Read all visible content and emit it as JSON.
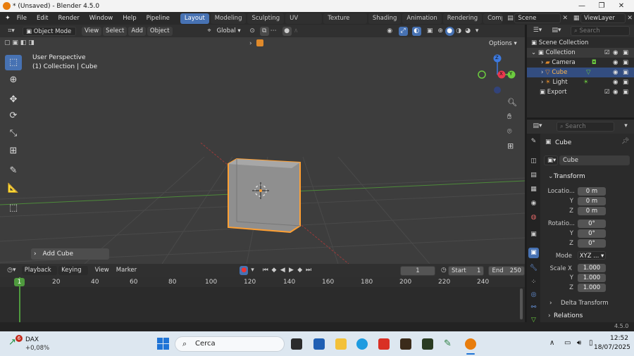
{
  "window": {
    "title": "* (Unsaved) - Blender 4.5.0"
  },
  "menu": {
    "items": [
      "File",
      "Edit",
      "Render",
      "Window",
      "Help",
      "Pipeline"
    ]
  },
  "workspaces": [
    "Layout",
    "Modeling",
    "Sculpting",
    "UV Editing",
    "Texture Paint",
    "Shading",
    "Animation",
    "Rendering",
    "Comp"
  ],
  "scene": {
    "name": "Scene",
    "view_layer": "ViewLayer"
  },
  "viewport_header": {
    "mode": "Object Mode",
    "menus": [
      "View",
      "Select",
      "Add",
      "Object"
    ],
    "transform_orientation": "Global",
    "options": "Options"
  },
  "viewport": {
    "perspective": "User Perspective",
    "context": "(1) Collection | Cube",
    "operator_panel": "Add Cube"
  },
  "gizmo": {
    "x": "X",
    "y": "Y",
    "z": "Z"
  },
  "timeline": {
    "menus": [
      "Playback",
      "Keying",
      "View",
      "Marker"
    ],
    "current_frame": "1",
    "start_label": "Start",
    "start": "1",
    "end_label": "End",
    "end": "250",
    "ruler": [
      "1",
      "20",
      "40",
      "60",
      "80",
      "100",
      "120",
      "140",
      "160",
      "180",
      "200",
      "220",
      "240"
    ]
  },
  "outliner": {
    "search_placeholder": "Search",
    "items": [
      {
        "label": "Scene Collection"
      },
      {
        "label": "Collection"
      },
      {
        "label": "Camera"
      },
      {
        "label": "Cube"
      },
      {
        "label": "Light"
      },
      {
        "label": "Export"
      }
    ]
  },
  "properties": {
    "search_placeholder": "Search",
    "object_name": "Cube",
    "datablock_name": "Cube",
    "transform_title": "Transform",
    "location_label": "Locatio...",
    "location": [
      "0 m",
      "0 m",
      "0 m"
    ],
    "rotation_label": "Rotatio...",
    "rotation": [
      "0°",
      "0°",
      "0°"
    ],
    "mode_label": "Mode",
    "mode_value": "XYZ ...",
    "scale_label": "Scale X",
    "scale": [
      "1.000",
      "1.000",
      "1.000"
    ],
    "axis_y": "Y",
    "axis_z": "Z",
    "delta_transform": "Delta Transform",
    "relations": "Relations"
  },
  "status": {
    "version": "4.5.0"
  },
  "taskbar": {
    "stock_name": "DAX",
    "stock_change": "+0,08%",
    "stock_badge": "6",
    "search_label": "Cerca",
    "time": "12:52",
    "date": "18/07/2025"
  },
  "colors": {
    "accent": "#4772b3",
    "selection": "#ffa033",
    "x_axis": "#e8384f",
    "y_axis": "#6ccc3f",
    "z_axis": "#3d7ae0"
  }
}
